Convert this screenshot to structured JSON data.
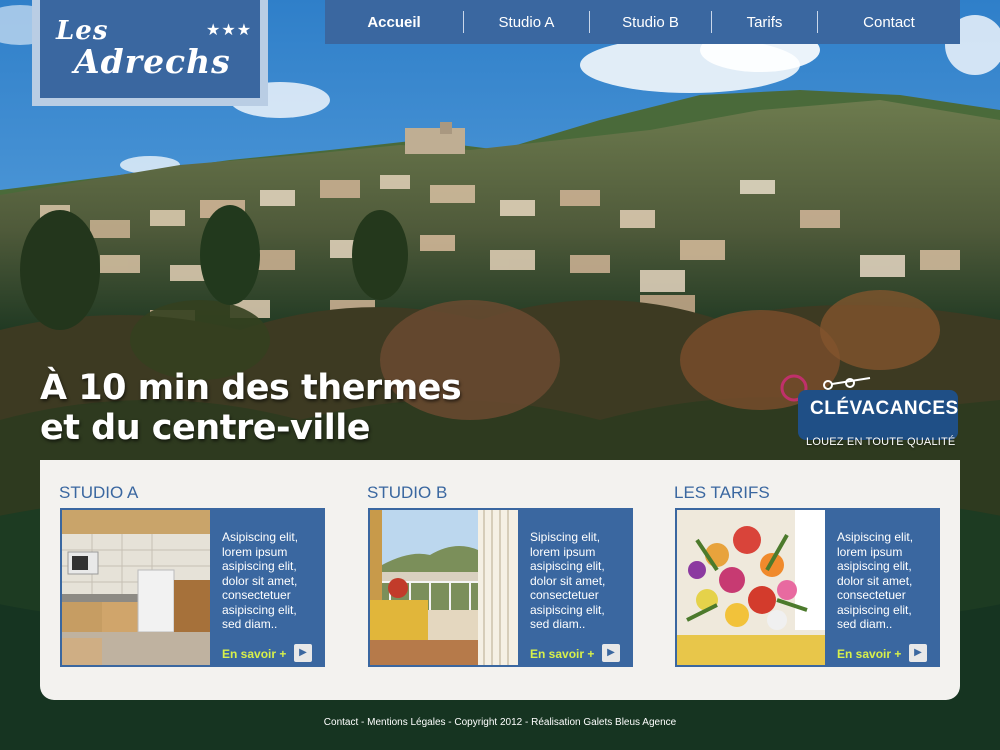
{
  "logo": {
    "line1": "Les",
    "line2": "Adrechs",
    "stars": "★★★"
  },
  "nav": {
    "items": [
      {
        "label": "Accueil",
        "active": true
      },
      {
        "label": "Studio A"
      },
      {
        "label": "Studio B"
      },
      {
        "label": "Tarifs"
      },
      {
        "label": "Contact"
      }
    ]
  },
  "hero": {
    "line1": "À 10 min des thermes",
    "line2": "et du centre-ville"
  },
  "badge": {
    "title": "CLÉVACANCES",
    "subtitle": "LOUEZ EN TOUTE QUALITÉ"
  },
  "cards": [
    {
      "title": "STUDIO A",
      "text": "Asipiscing elit, lorem ipsum asipiscing elit, dolor sit amet, consectetuer asipiscing elit, sed diam..",
      "more": "En savoir +"
    },
    {
      "title": "STUDIO B",
      "text": "Sipiscing elit, lorem ipsum asipiscing elit, dolor sit amet, consectetuer asipiscing elit, sed diam..",
      "more": "En savoir +"
    },
    {
      "title": "LES TARIFS",
      "text": "Asipiscing elit, lorem ipsum asipiscing elit, dolor sit amet, consectetuer asipiscing elit, sed diam..",
      "more": "En savoir +"
    }
  ],
  "footer": {
    "text": "Contact - Mentions Légales - Copyright 2012 - Réalisation Galets Bleus Agence"
  },
  "colors": {
    "brand_blue": "#3a67a0",
    "panel_bg": "#f3f2ef",
    "link_green": "#d8f04a"
  }
}
